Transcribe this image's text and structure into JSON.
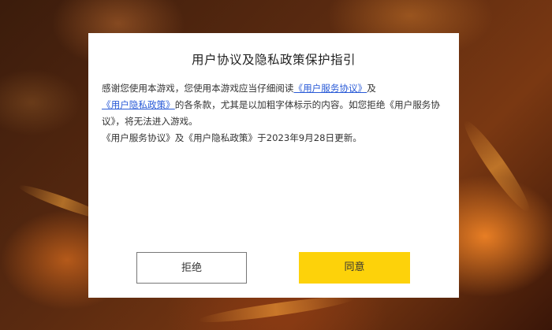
{
  "dialog": {
    "title": "用户协议及隐私政策保护指引",
    "text_1": "感谢您使用本游戏，您使用本游戏应当仔细阅读",
    "link_service": "《用户服务协议》",
    "text_2": "及",
    "link_privacy": "《用户隐私政策》",
    "text_3": "的各条款，尤其是以加粗字体标示的内容。如您拒绝《用户服务协议》，将无法进入游戏。",
    "update_note": "《用户服务协议》及《用户隐私政策》于2023年9月28日更新。"
  },
  "buttons": {
    "reject": "拒绝",
    "agree": "同意"
  },
  "colors": {
    "agree_button": "#fdd20a",
    "link": "#2a5bd7"
  }
}
